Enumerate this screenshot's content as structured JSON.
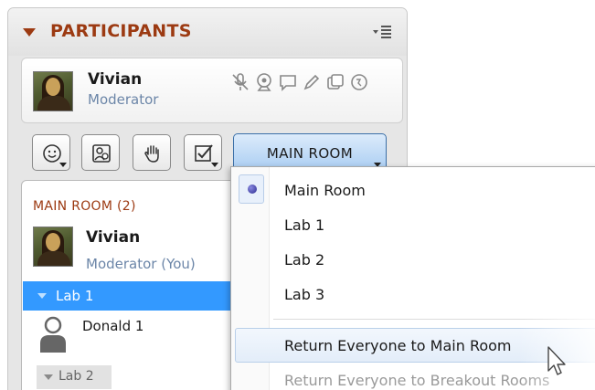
{
  "panel": {
    "title": "PARTICIPANTS"
  },
  "current_user": {
    "name": "Vivian",
    "role": "Moderator"
  },
  "toolbar": {
    "room_button_label": "MAIN ROOM"
  },
  "participant_list": {
    "heading": "MAIN ROOM (2)",
    "main_room_members": [
      {
        "name": "Vivian",
        "role": "Moderator (You)"
      }
    ],
    "labs": [
      {
        "label": "Lab 1",
        "selected": true,
        "members": [
          {
            "name": "Donald 1"
          }
        ]
      },
      {
        "label": "Lab 2",
        "selected": false
      }
    ]
  },
  "room_menu": {
    "rooms": [
      {
        "label": "Main Room",
        "checked": true
      },
      {
        "label": "Lab 1",
        "checked": false
      },
      {
        "label": "Lab 2",
        "checked": false
      },
      {
        "label": "Lab 3",
        "checked": false
      }
    ],
    "actions": [
      {
        "label": "Return Everyone to Main Room",
        "enabled": true,
        "hovered": true
      },
      {
        "label": "Return Everyone to Breakout Rooms",
        "enabled": false
      }
    ]
  },
  "colors": {
    "title_accent": "#9c3a12",
    "selection_blue": "#3399ff",
    "role_text": "#6c86a8"
  },
  "icons": {
    "header": [
      "collapse-triangle-icon",
      "panel-menu-icon"
    ],
    "status": [
      "microphone-off-icon",
      "webcam-icon",
      "chat-icon",
      "pencil-icon",
      "share-screen-icon",
      "globe-icon"
    ],
    "toolbar": [
      "emoticon-icon",
      "profile-settings-icon",
      "raise-hand-icon",
      "poll-checkbox-icon"
    ]
  }
}
